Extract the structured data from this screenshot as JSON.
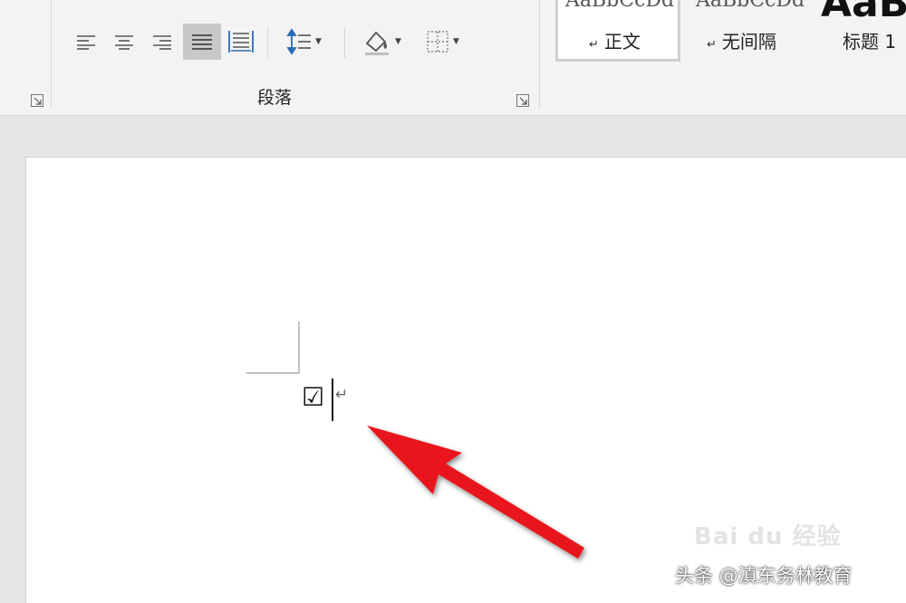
{
  "ribbon": {
    "paragraph_group_label": "段落",
    "styles": [
      {
        "preview": "AaBbCcDd",
        "name": "正文",
        "selected": true
      },
      {
        "preview": "AaBbCcDd",
        "name": "无间隔",
        "selected": false
      },
      {
        "preview": "AaB",
        "name": "标题 1",
        "selected": false
      }
    ]
  },
  "document": {
    "checkbox_symbol": "☑",
    "paragraph_mark": "↵"
  },
  "watermarks": {
    "baidu": "Bai du 经验",
    "toutiao": "头条 @滇东务林教育"
  },
  "colors": {
    "arrow": "#e8141a",
    "ribbon_bg": "#f3f3f3",
    "page_bg": "#ffffff"
  }
}
